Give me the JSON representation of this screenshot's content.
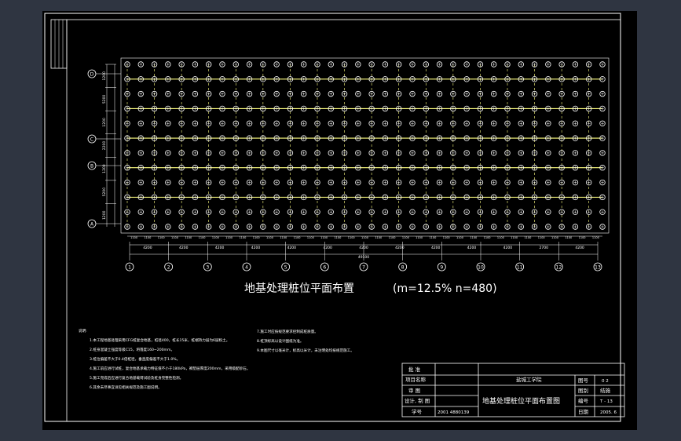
{
  "drawing": {
    "title": "地基处理桩位平面布置",
    "parameters": "(m=12.5%   n=480)",
    "colors": {
      "background": "#000000",
      "viewport": "#2f3541",
      "lines": "#ffffff",
      "piles": "#ffffff",
      "links": "#ffff80"
    }
  },
  "grid": {
    "axis_numbers": [
      "1",
      "2",
      "3",
      "4",
      "5",
      "6",
      "7",
      "8",
      "9",
      "10",
      "11",
      "12",
      "13"
    ],
    "axis_letters": [
      "A",
      "B",
      "C",
      "D"
    ],
    "bay_dims": [
      "4200",
      "4200",
      "4200",
      "4200",
      "4200",
      "4200",
      "4200",
      "4200",
      "4200",
      "4200",
      "4200",
      "2700",
      "4200"
    ],
    "total_dim": "49100",
    "left_dims": [
      "1200",
      "5200",
      "1200",
      "2200",
      "1200",
      "5200",
      "1200"
    ],
    "pile_spacing_label": "1100"
  },
  "notes": {
    "left": [
      "说明:",
      "1.本工程地基处理采用CFG桩复合地基，桩径400，桩长15米，桩端持力层为6层粉土。",
      "2.桩身混凝土强度等级C15，坍落度160~200mm。",
      "3.桩位偏差不大于0.4倍桩径，垂直度偏差不大于1.0%。",
      "4.施工前应进行试桩，复合地基承载力特征值不小于180kPa，褥垫层厚度200mm，采用级配砂石。",
      "5.施工完成后应进行复合地基载荷试验及桩身完整性检测。",
      "6.其余未尽事宜详见相关规范及施工图说明。"
    ],
    "right": [
      "7.施工时应按规范要求控制成桩质量。",
      "8.桩顶标高以设计图纸为准。",
      "9.本图尺寸以毫米计，标高以米计，未注明处均按规范施工。"
    ]
  },
  "title_block": {
    "approval": "批 准",
    "project_name": "项目名称",
    "review": "审 图",
    "design": "设计, 制 图",
    "student_no_label": "学号",
    "student_no": "2001 4880139",
    "school": "盐城工学院",
    "drawing_name": "地基处理桩位平面布置图",
    "drawing_no_label": "图号",
    "drawing_no": "0 2",
    "scale_label": "图别",
    "scale": "结施",
    "sheet_label": "编号",
    "sheet": "T - 13",
    "date_label": "日期",
    "date": "2005. 6"
  }
}
